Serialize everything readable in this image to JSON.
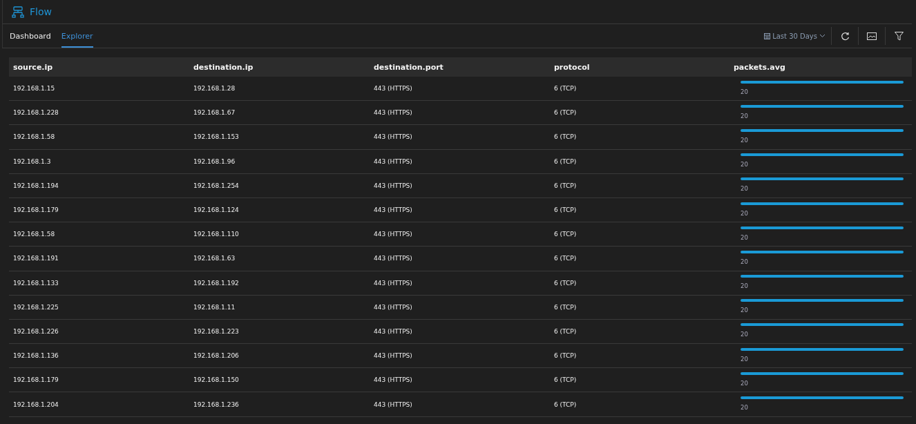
{
  "app": {
    "title": "Flow"
  },
  "tabs": [
    {
      "label": "Dashboard",
      "selected": false
    },
    {
      "label": "Explorer",
      "selected": true
    }
  ],
  "toolbar": {
    "date_range": "Last 30 Days"
  },
  "table": {
    "columns": [
      "source.ip",
      "destination.ip",
      "destination.port",
      "protocol",
      "packets.avg"
    ],
    "rows": [
      {
        "source_ip": "192.168.1.15",
        "destination_ip": "192.168.1.28",
        "destination_port": "443 (HTTPS)",
        "protocol": "6 (TCP)",
        "level": 1,
        "reading": "20"
      },
      {
        "source_ip": "192.168.1.228",
        "destination_ip": "192.168.1.67",
        "destination_port": "443 (HTTPS)",
        "protocol": "6 (TCP)",
        "level": 1,
        "reading": "20"
      },
      {
        "source_ip": "192.168.1.58",
        "destination_ip": "192.168.1.153",
        "destination_port": "443 (HTTPS)",
        "protocol": "6 (TCP)",
        "level": 1,
        "reading": "20"
      },
      {
        "source_ip": "192.168.1.3",
        "destination_ip": "192.168.1.96",
        "destination_port": "443 (HTTPS)",
        "protocol": "6 (TCP)",
        "level": 1,
        "reading": "20"
      },
      {
        "source_ip": "192.168.1.194",
        "destination_ip": "192.168.1.254",
        "destination_port": "443 (HTTPS)",
        "protocol": "6 (TCP)",
        "level": 1,
        "reading": "20"
      },
      {
        "source_ip": "192.168.1.179",
        "destination_ip": "192.168.1.124",
        "destination_port": "443 (HTTPS)",
        "protocol": "6 (TCP)",
        "level": 1,
        "reading": "20"
      },
      {
        "source_ip": "192.168.1.58",
        "destination_ip": "192.168.1.110",
        "destination_port": "443 (HTTPS)",
        "protocol": "6 (TCP)",
        "level": 1,
        "reading": "20"
      },
      {
        "source_ip": "192.168.1.191",
        "destination_ip": "192.168.1.63",
        "destination_port": "443 (HTTPS)",
        "protocol": "6 (TCP)",
        "level": 1,
        "reading": "20"
      },
      {
        "source_ip": "192.168.1.133",
        "destination_ip": "192.168.1.192",
        "destination_port": "443 (HTTPS)",
        "protocol": "6 (TCP)",
        "level": 1,
        "reading": "20"
      },
      {
        "source_ip": "192.168.1.225",
        "destination_ip": "192.168.1.11",
        "destination_port": "443 (HTTPS)",
        "protocol": "6 (TCP)",
        "level": 1,
        "reading": "20"
      },
      {
        "source_ip": "192.168.1.226",
        "destination_ip": "192.168.1.223",
        "destination_port": "443 (HTTPS)",
        "protocol": "6 (TCP)",
        "level": 1,
        "reading": "20"
      },
      {
        "source_ip": "192.168.1.136",
        "destination_ip": "192.168.1.206",
        "destination_port": "443 (HTTPS)",
        "protocol": "6 (TCP)",
        "level": 1,
        "reading": "20"
      },
      {
        "source_ip": "192.168.1.179",
        "destination_ip": "192.168.1.150",
        "destination_port": "443 (HTTPS)",
        "protocol": "6 (TCP)",
        "level": 1,
        "reading": "20"
      },
      {
        "source_ip": "192.168.1.204",
        "destination_ip": "192.168.1.236",
        "destination_port": "443 (HTTPS)",
        "protocol": "6 (TCP)",
        "level": 1,
        "reading": "20"
      }
    ]
  }
}
